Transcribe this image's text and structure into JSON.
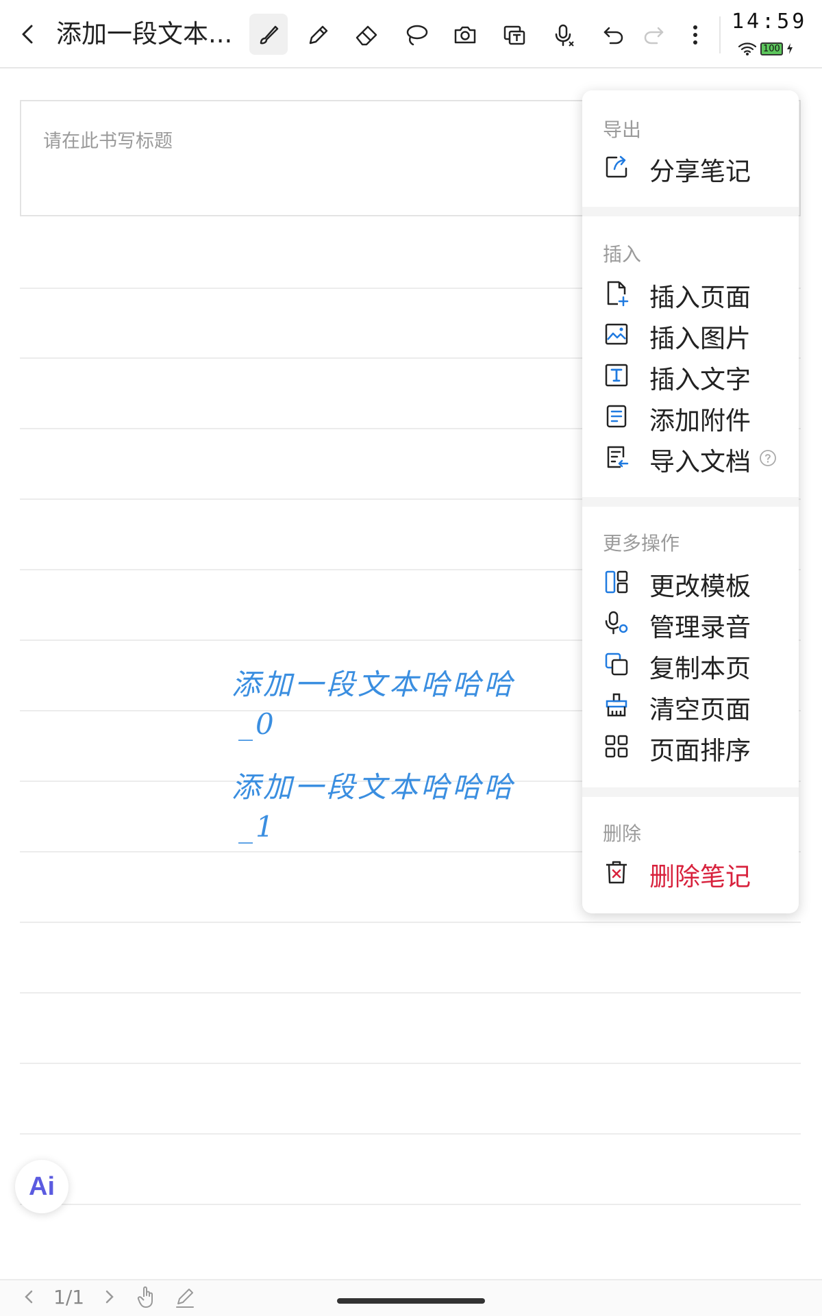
{
  "toolbar": {
    "title": "添加一段文本...",
    "tools": [
      "brush-icon",
      "pencil-icon",
      "eraser-icon",
      "lasso-icon",
      "camera-icon",
      "text-recognize-icon",
      "microphone-icon",
      "undo-icon",
      "redo-icon",
      "more-icon"
    ]
  },
  "status": {
    "time": "14:59",
    "battery": "100"
  },
  "page": {
    "title_placeholder": "请在此书写标题",
    "handwriting": [
      "添加一段文本哈哈哈",
      "_0",
      "添加一段文本哈哈哈",
      "_1"
    ],
    "handwriting_color": "#3a8ee0"
  },
  "menu": {
    "groups": [
      {
        "header": "导出",
        "items": [
          {
            "label": "分享笔记",
            "icon": "share-icon"
          }
        ]
      },
      {
        "header": "插入",
        "items": [
          {
            "label": "插入页面",
            "icon": "insert-page-icon"
          },
          {
            "label": "插入图片",
            "icon": "insert-image-icon"
          },
          {
            "label": "插入文字",
            "icon": "insert-text-icon"
          },
          {
            "label": "添加附件",
            "icon": "attachment-icon"
          },
          {
            "label": "导入文档",
            "icon": "import-document-icon"
          }
        ]
      },
      {
        "header": "更多操作",
        "items": [
          {
            "label": "更改模板",
            "icon": "template-icon"
          },
          {
            "label": "管理录音",
            "icon": "recording-icon"
          },
          {
            "label": "复制本页",
            "icon": "copy-page-icon"
          },
          {
            "label": "清空页面",
            "icon": "clear-page-icon"
          },
          {
            "label": "页面排序",
            "icon": "sort-pages-icon"
          }
        ]
      },
      {
        "header": "删除",
        "items": [
          {
            "label": "删除笔记",
            "icon": "delete-icon",
            "danger": true
          }
        ]
      }
    ],
    "danger_color": "#d8223d",
    "accent_color": "#1f7ae0"
  },
  "ai_button": {
    "label": "Ai"
  },
  "bottom": {
    "page_indicator": "1/1"
  }
}
